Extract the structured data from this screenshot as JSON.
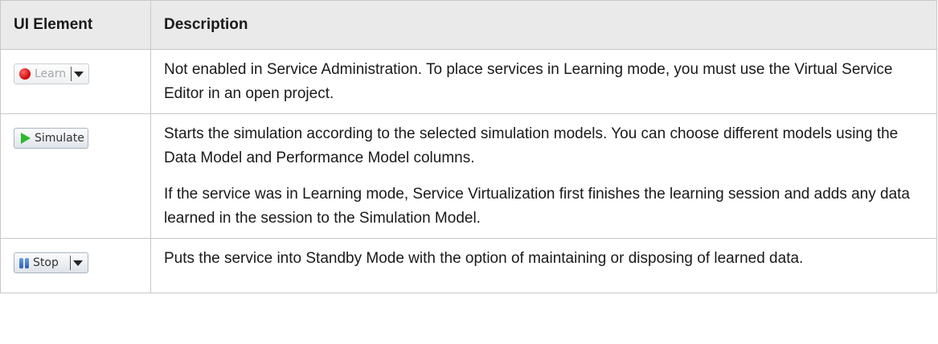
{
  "table": {
    "headers": {
      "ui_element": "UI Element",
      "description": "Description"
    },
    "rows": [
      {
        "button": {
          "label": "Learn",
          "icon": "record-icon",
          "has_dropdown": true,
          "enabled": false
        },
        "description": [
          "Not enabled in Service Administration. To place services in Learning mode, you must use the Virtual Service Editor in an open project."
        ]
      },
      {
        "button": {
          "label": "Simulate",
          "icon": "play-icon",
          "has_dropdown": false,
          "enabled": true
        },
        "description": [
          "Starts the simulation according to the selected simulation models. You can choose different models using the Data Model and Performance Model columns.",
          "If the service was in Learning mode, Service Virtualization first finishes the learning session and adds any data learned in the session to the Simulation Model."
        ]
      },
      {
        "button": {
          "label": "Stop",
          "icon": "pause-icon",
          "has_dropdown": true,
          "enabled": true
        },
        "description": [
          "Puts the service into Standby Mode with the option of maintaining or disposing of learned data."
        ]
      }
    ]
  },
  "colors": {
    "header_bg": "#eaeaea",
    "border": "#c8c8c8",
    "record_red": "#d00000",
    "play_green": "#2db82d",
    "pause_blue": "#2c5fb3"
  }
}
